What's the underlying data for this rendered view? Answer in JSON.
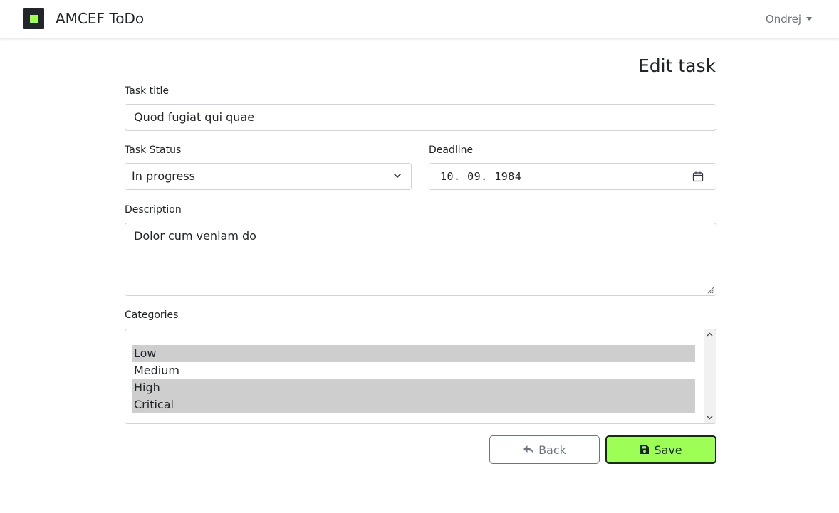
{
  "navbar": {
    "brand_title": "AMCEF ToDo",
    "user_name": "Ondrej",
    "brand_color": "#9dff4e"
  },
  "form": {
    "page_title": "Edit task",
    "task_title": {
      "label": "Task title",
      "value": "Quod fugiat qui quae"
    },
    "task_status": {
      "label": "Task Status",
      "value": "In progress"
    },
    "deadline": {
      "label": "Deadline",
      "value": "10. 09. 1984"
    },
    "description": {
      "label": "Description",
      "value": "Dolor cum veniam do"
    },
    "categories": {
      "label": "Categories",
      "options": [
        {
          "label": "Low",
          "selected": true
        },
        {
          "label": "Medium",
          "selected": false
        },
        {
          "label": "High",
          "selected": true
        },
        {
          "label": "Critical",
          "selected": true
        }
      ]
    },
    "back_label": "Back",
    "save_label": "Save",
    "save_color": "#9dff55"
  },
  "icons": {
    "chevron": "chevron-down-icon",
    "calendar": "calendar-icon",
    "back": "reply-icon",
    "save": "floppy-disk-icon"
  }
}
